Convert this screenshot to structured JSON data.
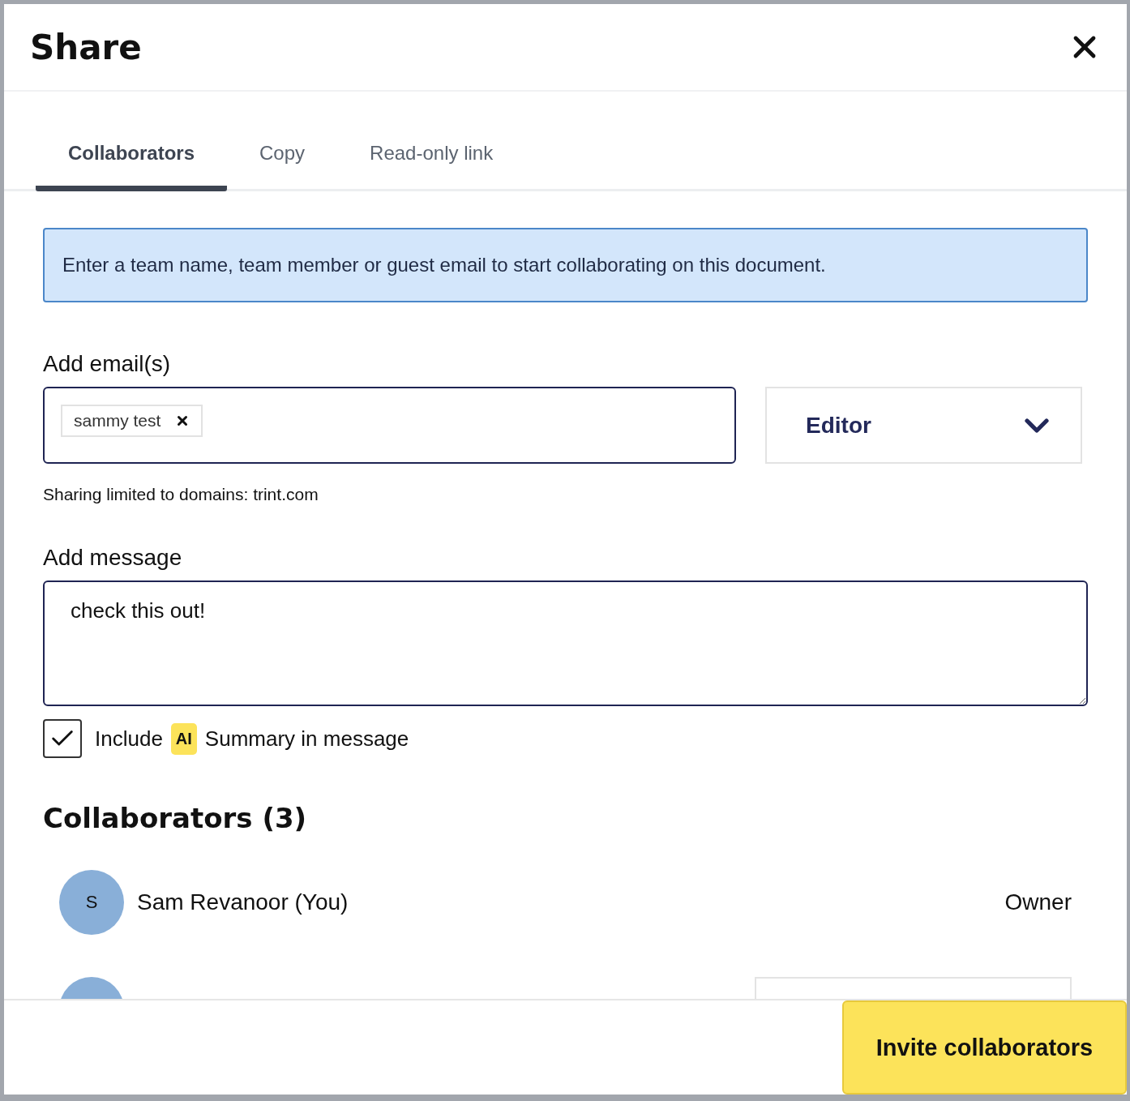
{
  "dialog": {
    "title": "Share"
  },
  "tabs": [
    {
      "label": "Collaborators",
      "selected": true
    },
    {
      "label": "Copy",
      "selected": false
    },
    {
      "label": "Read-only link",
      "selected": false
    }
  ],
  "notice": "Enter a team name, team member or guest email to start collaborating on this document.",
  "email": {
    "label": "Add email(s)",
    "chips": [
      "sammy test"
    ],
    "role": "Editor",
    "helper": "Sharing limited to domains: trint.com"
  },
  "message": {
    "label": "Add message",
    "value": "check this out!"
  },
  "include_summary": {
    "checked": true,
    "before": "Include",
    "badge": "AI",
    "after": "Summary in message"
  },
  "collaborators": {
    "heading": "Collaborators (3)",
    "rows": [
      {
        "kind": "owner",
        "initial": "S",
        "name": "Sam Revanoor (You)",
        "role": "Owner"
      },
      {
        "kind": "select"
      }
    ]
  },
  "footer": {
    "button": "Invite collaborators"
  }
}
